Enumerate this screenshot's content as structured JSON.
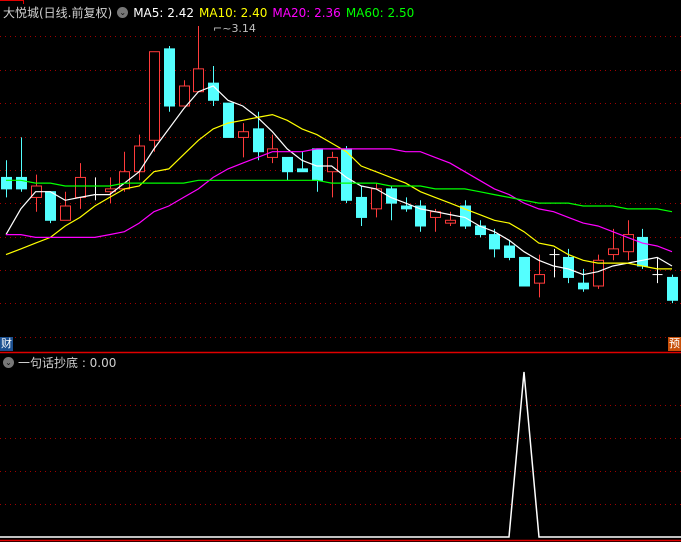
{
  "header": {
    "title": "大悦城(日线.前复权)",
    "dropdown_icon": "chevron-down-icon",
    "ma": [
      {
        "label": "MA5: 2.42",
        "color": "#ffffff"
      },
      {
        "label": "MA10: 2.40",
        "color": "#ffff00"
      },
      {
        "label": "MA20: 2.36",
        "color": "#ff00ff"
      },
      {
        "label": "MA60: 2.50",
        "color": "#00ff00"
      }
    ]
  },
  "high_marker": "3.14",
  "badges": {
    "left": "财",
    "right": "预"
  },
  "indicator": {
    "label": "一句话抄底 : 0.00"
  },
  "colors": {
    "up": "#ff3b3b",
    "down": "#54ffff",
    "grid": "#a00000",
    "border": "#e00000"
  },
  "chart_data": {
    "type": "candlestick",
    "title": "大悦城(日线.前复权)",
    "ylim": [
      2.08,
      3.16
    ],
    "candles": [
      [
        2.61,
        2.67,
        2.54,
        2.57
      ],
      [
        2.61,
        2.75,
        2.56,
        2.57
      ],
      [
        2.54,
        2.62,
        2.49,
        2.58
      ],
      [
        2.56,
        2.56,
        2.45,
        2.46
      ],
      [
        2.46,
        2.56,
        2.46,
        2.51
      ],
      [
        2.54,
        2.66,
        2.5,
        2.61
      ],
      [
        2.58,
        2.61,
        2.53,
        2.58
      ],
      [
        2.56,
        2.61,
        2.52,
        2.57
      ],
      [
        2.57,
        2.7,
        2.56,
        2.63
      ],
      [
        2.63,
        2.76,
        2.6,
        2.72
      ],
      [
        2.74,
        3.05,
        2.7,
        3.05
      ],
      [
        3.06,
        3.07,
        2.84,
        2.86
      ],
      [
        2.86,
        2.95,
        2.86,
        2.93
      ],
      [
        2.91,
        3.14,
        2.91,
        2.99
      ],
      [
        2.94,
        3.0,
        2.86,
        2.88
      ],
      [
        2.87,
        2.87,
        2.75,
        2.75
      ],
      [
        2.75,
        2.8,
        2.68,
        2.77
      ],
      [
        2.78,
        2.84,
        2.67,
        2.7
      ],
      [
        2.68,
        2.76,
        2.66,
        2.71
      ],
      [
        2.68,
        2.68,
        2.6,
        2.63
      ],
      [
        2.64,
        2.7,
        2.63,
        2.63
      ],
      [
        2.71,
        2.71,
        2.56,
        2.6
      ],
      [
        2.63,
        2.7,
        2.54,
        2.68
      ],
      [
        2.71,
        2.72,
        2.52,
        2.53
      ],
      [
        2.54,
        2.58,
        2.44,
        2.47
      ],
      [
        2.5,
        2.59,
        2.47,
        2.57
      ],
      [
        2.57,
        2.58,
        2.46,
        2.52
      ],
      [
        2.51,
        2.54,
        2.49,
        2.5
      ],
      [
        2.51,
        2.53,
        2.42,
        2.44
      ],
      [
        2.47,
        2.5,
        2.42,
        2.49
      ],
      [
        2.45,
        2.49,
        2.44,
        2.46
      ],
      [
        2.51,
        2.53,
        2.43,
        2.44
      ],
      [
        2.44,
        2.46,
        2.4,
        2.41
      ],
      [
        2.41,
        2.43,
        2.33,
        2.36
      ],
      [
        2.37,
        2.39,
        2.32,
        2.33
      ],
      [
        2.33,
        2.33,
        2.23,
        2.23
      ],
      [
        2.24,
        2.34,
        2.19,
        2.27
      ],
      [
        2.34,
        2.36,
        2.26,
        2.34
      ],
      [
        2.33,
        2.36,
        2.24,
        2.26
      ],
      [
        2.24,
        2.29,
        2.21,
        2.22
      ],
      [
        2.23,
        2.34,
        2.22,
        2.32
      ],
      [
        2.34,
        2.43,
        2.32,
        2.36
      ],
      [
        2.35,
        2.46,
        2.32,
        2.41
      ],
      [
        2.4,
        2.43,
        2.29,
        2.3
      ],
      [
        2.27,
        2.33,
        2.24,
        2.27
      ],
      [
        2.26,
        2.27,
        2.17,
        2.18
      ]
    ],
    "candle_fields": [
      "open",
      "high",
      "low",
      "close"
    ],
    "series": [
      {
        "name": "MA5",
        "color": "#ffffff",
        "values": [
          2.41,
          2.5,
          2.56,
          2.56,
          2.53,
          2.54,
          2.55,
          2.55,
          2.59,
          2.63,
          2.71,
          2.78,
          2.85,
          2.91,
          2.93,
          2.88,
          2.86,
          2.82,
          2.77,
          2.71,
          2.67,
          2.65,
          2.65,
          2.61,
          2.58,
          2.57,
          2.54,
          2.52,
          2.5,
          2.49,
          2.48,
          2.47,
          2.44,
          2.42,
          2.39,
          2.35,
          2.32,
          2.3,
          2.29,
          2.27,
          2.28,
          2.3,
          2.31,
          2.32,
          2.33,
          2.3
        ]
      },
      {
        "name": "MA10",
        "color": "#ffff00",
        "values": [
          2.34,
          2.36,
          2.38,
          2.4,
          2.44,
          2.47,
          2.51,
          2.54,
          2.57,
          2.58,
          2.63,
          2.64,
          2.69,
          2.74,
          2.78,
          2.8,
          2.81,
          2.82,
          2.83,
          2.81,
          2.78,
          2.76,
          2.73,
          2.7,
          2.65,
          2.63,
          2.61,
          2.59,
          2.56,
          2.54,
          2.52,
          2.5,
          2.48,
          2.46,
          2.45,
          2.42,
          2.38,
          2.37,
          2.34,
          2.32,
          2.31,
          2.31,
          2.31,
          2.3,
          2.29,
          2.29
        ]
      },
      {
        "name": "MA20",
        "color": "#ff00ff",
        "values": [
          2.41,
          2.41,
          2.4,
          2.4,
          2.4,
          2.4,
          2.4,
          2.41,
          2.42,
          2.45,
          2.49,
          2.51,
          2.54,
          2.57,
          2.61,
          2.64,
          2.66,
          2.68,
          2.7,
          2.7,
          2.7,
          2.71,
          2.71,
          2.71,
          2.71,
          2.71,
          2.71,
          2.7,
          2.7,
          2.68,
          2.66,
          2.63,
          2.6,
          2.57,
          2.55,
          2.52,
          2.5,
          2.49,
          2.47,
          2.45,
          2.44,
          2.42,
          2.4,
          2.38,
          2.37,
          2.35
        ]
      },
      {
        "name": "MA60",
        "color": "#00ff00",
        "values": [
          2.6,
          2.6,
          2.59,
          2.59,
          2.58,
          2.58,
          2.58,
          2.58,
          2.59,
          2.59,
          2.59,
          2.59,
          2.59,
          2.6,
          2.6,
          2.6,
          2.6,
          2.6,
          2.6,
          2.6,
          2.6,
          2.6,
          2.59,
          2.59,
          2.59,
          2.59,
          2.58,
          2.58,
          2.58,
          2.57,
          2.57,
          2.57,
          2.56,
          2.55,
          2.54,
          2.53,
          2.52,
          2.52,
          2.52,
          2.51,
          2.51,
          2.51,
          2.5,
          2.5,
          2.5,
          2.49
        ]
      }
    ],
    "indicator_series": {
      "name": "一句话抄底",
      "ylim": [
        0,
        1
      ],
      "values": [
        0,
        0,
        0,
        0,
        0,
        0,
        0,
        0,
        0,
        0,
        0,
        0,
        0,
        0,
        0,
        0,
        0,
        0,
        0,
        0,
        0,
        0,
        0,
        0,
        0,
        0,
        0,
        0,
        0,
        0,
        0,
        0,
        0,
        0,
        0,
        1,
        0,
        0,
        0,
        0,
        0,
        0,
        0,
        0,
        0,
        0
      ]
    }
  }
}
